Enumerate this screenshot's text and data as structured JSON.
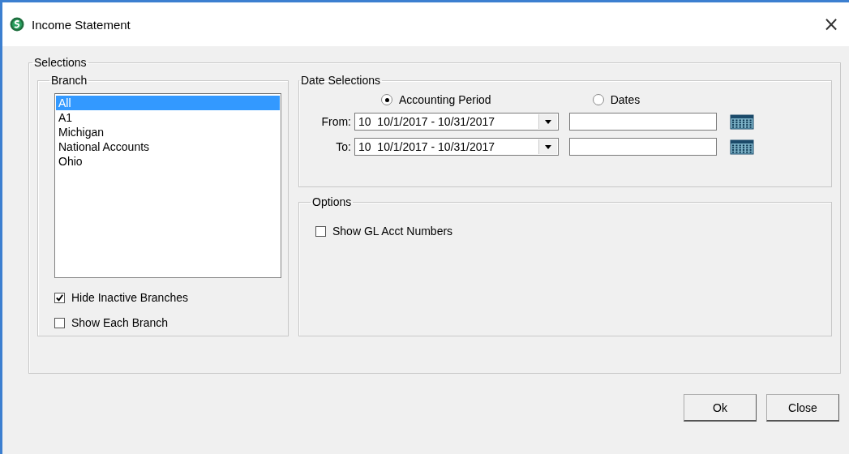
{
  "window": {
    "title": "Income Statement",
    "close": "×"
  },
  "selections": {
    "title": "Selections",
    "branch": {
      "title": "Branch",
      "items": [
        {
          "label": "All",
          "selected": true
        },
        {
          "label": "A1",
          "selected": false
        },
        {
          "label": "Michigan",
          "selected": false
        },
        {
          "label": "National Accounts",
          "selected": false
        },
        {
          "label": "Ohio",
          "selected": false
        }
      ],
      "checkboxes": [
        {
          "label": "Hide Inactive Branches",
          "checked": true
        },
        {
          "label": "Show Each Branch",
          "checked": false
        }
      ]
    },
    "date_selections": {
      "title": "Date Selections",
      "modes": [
        {
          "label": "Accounting Period",
          "selected": true
        },
        {
          "label": "Dates",
          "selected": false
        }
      ],
      "rows": [
        {
          "label": "From:",
          "period": "10  10/1/2017 - 10/31/2017",
          "date": ""
        },
        {
          "label": "To:",
          "period": "10  10/1/2017 - 10/31/2017",
          "date": ""
        }
      ]
    },
    "options": {
      "title": "Options",
      "checkboxes": [
        {
          "label": "Show GL Acct Numbers",
          "checked": false
        }
      ]
    }
  },
  "buttons": [
    "Ok",
    "Close"
  ]
}
